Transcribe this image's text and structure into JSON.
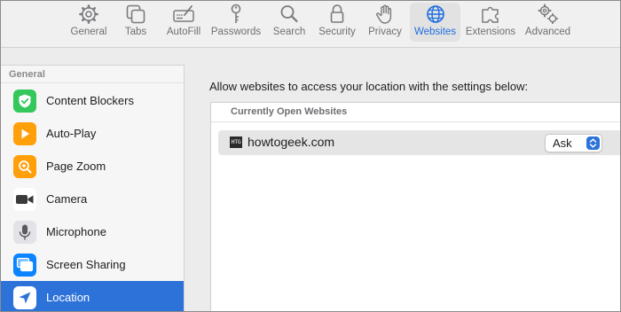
{
  "toolbar": {
    "items": [
      {
        "label": "General",
        "icon": "gear-icon"
      },
      {
        "label": "Tabs",
        "icon": "tabs-icon"
      },
      {
        "label": "AutoFill",
        "icon": "autofill-icon"
      },
      {
        "label": "Passwords",
        "icon": "key-icon"
      },
      {
        "label": "Search",
        "icon": "search-icon"
      },
      {
        "label": "Security",
        "icon": "lock-icon"
      },
      {
        "label": "Privacy",
        "icon": "hand-icon"
      },
      {
        "label": "Websites",
        "icon": "globe-icon",
        "active": true
      },
      {
        "label": "Extensions",
        "icon": "puzzle-icon"
      },
      {
        "label": "Advanced",
        "icon": "gears-icon"
      }
    ],
    "active_color": "#1f6ee0"
  },
  "sidebar": {
    "header": "General",
    "items": [
      {
        "label": "Content Blockers",
        "icon": "check-shield-icon",
        "color": "#34c759"
      },
      {
        "label": "Auto-Play",
        "icon": "play-icon",
        "color": "#ff9f0a"
      },
      {
        "label": "Page Zoom",
        "icon": "zoom-icon",
        "color": "#ff9f0a"
      },
      {
        "label": "Camera",
        "icon": "camera-icon",
        "color": "#3a3a3c"
      },
      {
        "label": "Microphone",
        "icon": "microphone-icon",
        "color": "#d1d1d6"
      },
      {
        "label": "Screen Sharing",
        "icon": "screens-icon",
        "color": "#0a84ff"
      },
      {
        "label": "Location",
        "icon": "location-arrow-icon",
        "color": "#ffffff",
        "selected": true
      }
    ],
    "selected_color": "#2d72d9"
  },
  "main": {
    "description": "Allow websites to access your location with the settings below:",
    "section_header": "Currently Open Websites",
    "sites": [
      {
        "favicon_text": "HTG",
        "name": "howtogeek.com",
        "setting": "Ask"
      }
    ]
  }
}
